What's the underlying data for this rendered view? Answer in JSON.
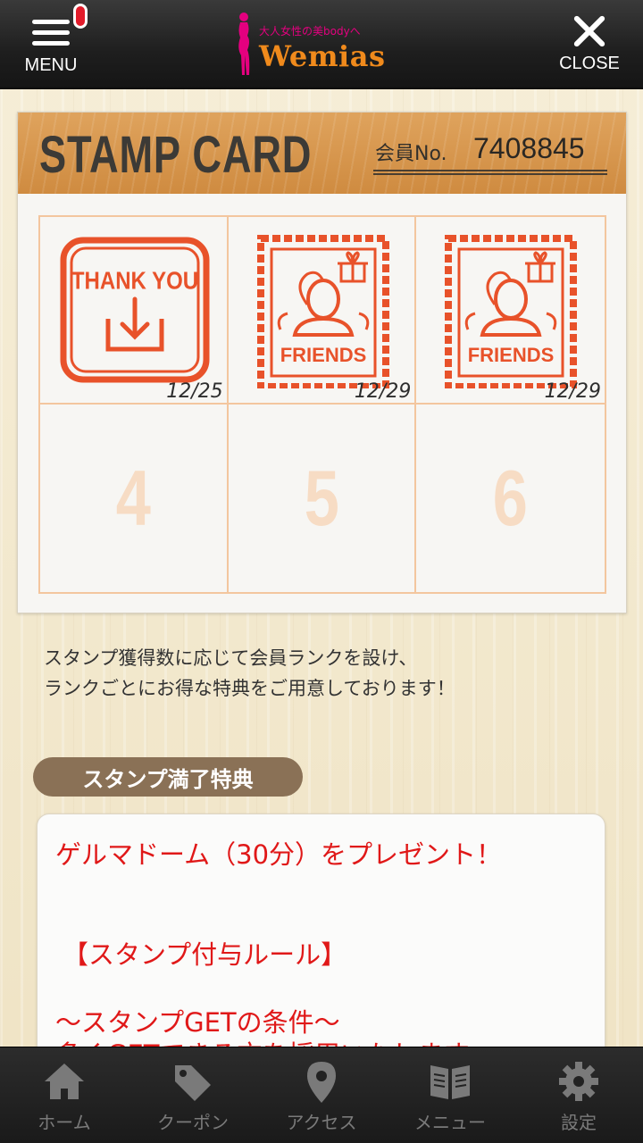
{
  "header": {
    "menu_label": "MENU",
    "close_label": "CLOSE",
    "logo_tagline": "大人女性の美bodyへ",
    "logo_name": "Wemias"
  },
  "stamp_card": {
    "title": "STAMP CARD",
    "member_label": "会員No.",
    "member_number": "7408845",
    "cells": [
      {
        "stamp": "THANK YOU",
        "date": "12/25"
      },
      {
        "stamp": "FRIENDS",
        "date": "12/29"
      },
      {
        "stamp": "FRIENDS",
        "date": "12/29"
      },
      {
        "number": "4"
      },
      {
        "number": "5"
      },
      {
        "number": "6"
      }
    ]
  },
  "description": {
    "line1": "スタンプ獲得数に応じて会員ランクを設け、",
    "line2": "ランクごとにお得な特典をご用意しております！"
  },
  "reward": {
    "tag": "スタンプ満了特典",
    "lines": [
      "ゲルマドーム（30分）をプレゼント！",
      "【スタンプ付与ルール】",
      "～スタンプGETの条件～",
      "多くGETできる方を採用いたします"
    ]
  },
  "tabbar": {
    "home": "ホーム",
    "coupon": "クーポン",
    "access": "アクセス",
    "menu": "メニュー",
    "settings": "設定"
  },
  "colors": {
    "stamp_red": "#e8522a",
    "reward_red": "#e01818",
    "card_header": "#d6954a"
  }
}
